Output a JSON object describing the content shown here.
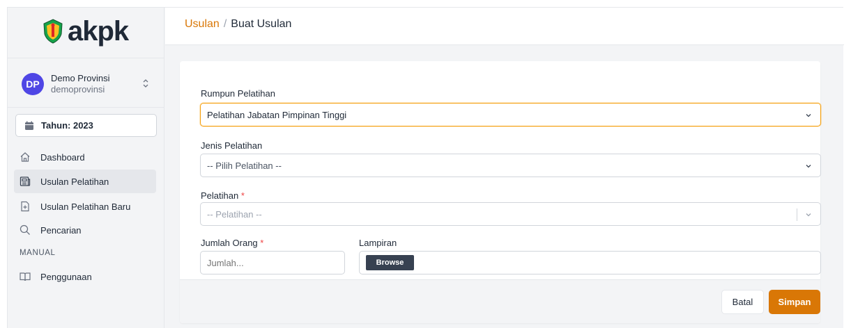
{
  "app": {
    "logo_text": "akpk"
  },
  "user": {
    "initials": "DP",
    "name": "Demo Provinsi",
    "username": "demoprovinsi"
  },
  "year_button": {
    "label": "Tahun: 2023"
  },
  "sidebar": {
    "items": [
      {
        "label": "Dashboard",
        "icon": "home-icon"
      },
      {
        "label": "Usulan Pelatihan",
        "icon": "newspaper-icon",
        "active": true
      },
      {
        "label": "Usulan Pelatihan Baru",
        "icon": "document-plus-icon"
      },
      {
        "label": "Pencarian",
        "icon": "search-icon"
      }
    ],
    "section_manual": "MANUAL",
    "manual_items": [
      {
        "label": "Penggunaan",
        "icon": "book-open-icon"
      }
    ]
  },
  "breadcrumb": {
    "parent": "Usulan",
    "separator": "/",
    "current": "Buat Usulan"
  },
  "form": {
    "rumpun": {
      "label": "Rumpun Pelatihan",
      "value": "Pelatihan Jabatan Pimpinan Tinggi"
    },
    "jenis": {
      "label": "Jenis Pelatihan",
      "placeholder": "-- Pilih Pelatihan --"
    },
    "pelatihan": {
      "label": "Pelatihan",
      "required_mark": "*",
      "placeholder": "-- Pelatihan --"
    },
    "jumlah": {
      "label": "Jumlah Orang",
      "required_mark": "*",
      "placeholder": "Jumlah..."
    },
    "lampiran": {
      "label": "Lampiran",
      "browse_label": "Browse"
    }
  },
  "footer": {
    "cancel_label": "Batal",
    "save_label": "Simpan"
  },
  "colors": {
    "accent": "#d97706",
    "avatar": "#4f46e5",
    "focus_border": "#f59e0b",
    "required": "#ef4444"
  }
}
